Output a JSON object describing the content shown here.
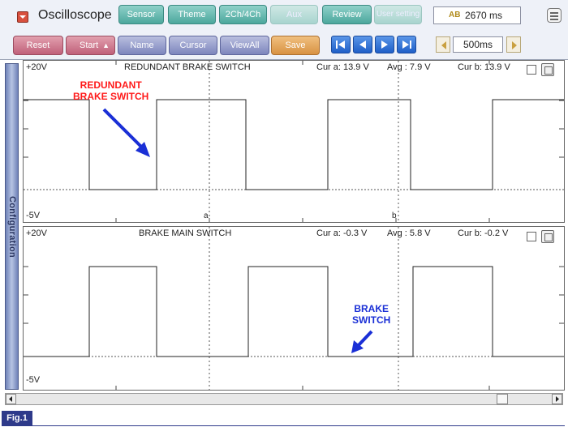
{
  "app": {
    "title": "Oscilloscope"
  },
  "toolbar1": {
    "buttons": [
      {
        "label": "Sensor"
      },
      {
        "label": "Theme"
      },
      {
        "label": "2Ch/4Ch"
      },
      {
        "label": "Aux"
      },
      {
        "label": "Review"
      },
      {
        "label": "User setting"
      }
    ],
    "readout": {
      "icon": "AB",
      "value": "2670 ms"
    }
  },
  "toolbar2": {
    "buttons": [
      {
        "label": "Reset"
      },
      {
        "label": "Start"
      },
      {
        "label": "Name"
      },
      {
        "label": "Cursor"
      },
      {
        "label": "ViewAll"
      },
      {
        "label": "Save"
      }
    ],
    "timebase": "500ms"
  },
  "sidebar": {
    "label": "Configuration"
  },
  "channel1": {
    "title": "REDUNDANT BRAKE SWITCH",
    "ymax": "+20V",
    "ymin": "-5V",
    "cur_a": "Cur a: 13.9 V",
    "avg": "Avg  : 7.9 V",
    "cur_b": "Cur b: 13.9 V",
    "cursor_a": "a",
    "cursor_b": "b",
    "annotation": "REDUNDANT\nBRAKE SWITCH"
  },
  "channel2": {
    "title": "BRAKE MAIN SWITCH",
    "ymax": "+20V",
    "ymin": "-5V",
    "cur_a": "Cur a: -0.3 V",
    "avg": "Avg  : 5.8 V",
    "cur_b": "Cur b: -0.2 V",
    "annotation": "BRAKE\nSWITCH"
  },
  "colors": {
    "annotation_red": "#ff1a1a",
    "annotation_blue": "#1a2fd6",
    "fig_label_bg": "#2e3a8a"
  },
  "figure": {
    "label": "Fig.1"
  }
}
